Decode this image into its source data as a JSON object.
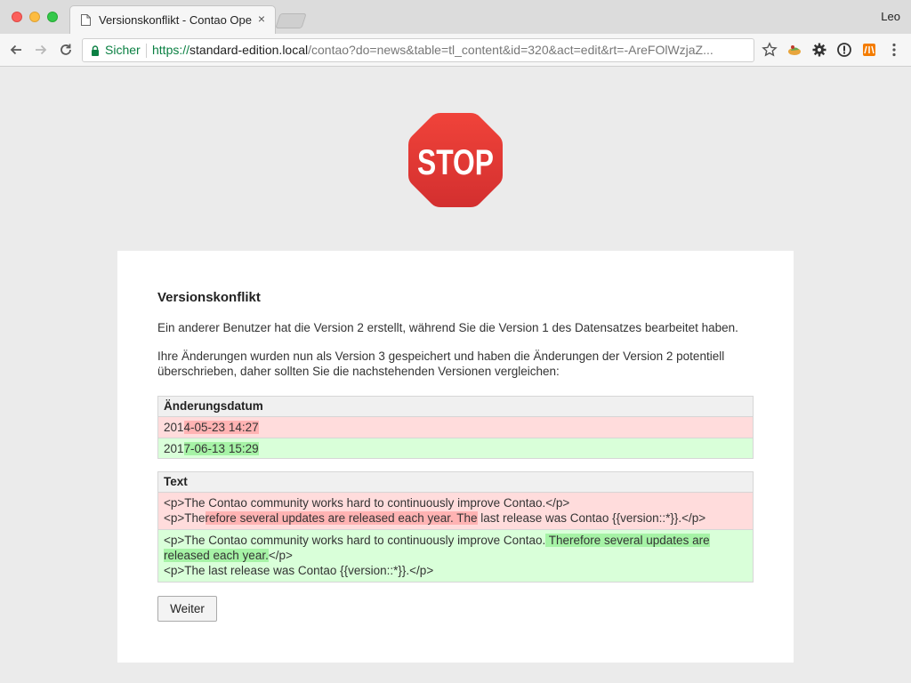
{
  "browser": {
    "tab_title": "Versionskonflikt - Contao Open Source CMS",
    "tab_close": "×",
    "user_name": "Leo",
    "secure_label": "Sicher",
    "url_scheme": "https://",
    "url_host": "standard-edition.local",
    "url_path": "/contao?do=news&table=tl_content&id=320&act=edit&rt=-AreFOlWzjaZ...",
    "icons": [
      "back-arrow-icon",
      "forward-arrow-icon",
      "reload-icon",
      "lock-icon",
      "star-icon",
      "extension-icon",
      "gear-icon",
      "info-icon",
      "contao-icon",
      "menu-icon"
    ]
  },
  "page": {
    "stop_text": "STOP",
    "heading": "Versionskonflikt",
    "paragraph1": "Ein anderer Benutzer hat die Version 2 erstellt, während Sie die Version 1 des Datensatzes bearbeitet haben.",
    "paragraph2": "Ihre Änderungen wurden nun als Version 3 gespeichert und haben die Änderungen der Version 2 potentiell überschrieben, daher sollten Sie die nachstehenden Versionen vergleichen:",
    "date_diff": {
      "header": "Änderungsdatum",
      "old_prefix": "201",
      "old_changed": "4-05-23 14:27",
      "new_prefix": "201",
      "new_changed": "7-06-13 15:29"
    },
    "text_diff": {
      "header": "Text",
      "old_line1": "<p>The Contao community works hard to continuously improve Contao.</p>",
      "old_line2_prefix": "<p>The",
      "old_line2_changed": "refore several updates are released each year. The",
      "old_line2_suffix": " last release was Contao {{version::*}}.</p>",
      "new_line1_prefix": "<p>The Contao community works hard to continuously improve Contao.",
      "new_line1_changed": " Therefore several updates are released each year.",
      "new_line1_suffix": "</p>",
      "new_line2": "<p>The last release was Contao {{version::*}}.</p>"
    },
    "continue_button": "Weiter"
  },
  "colors": {
    "deleted_bg": "#ffdcdc",
    "deleted_highlight": "#ffb3b3",
    "inserted_bg": "#d9ffd9",
    "inserted_highlight": "#a6f3a6",
    "stop_sign": "#e53935"
  }
}
